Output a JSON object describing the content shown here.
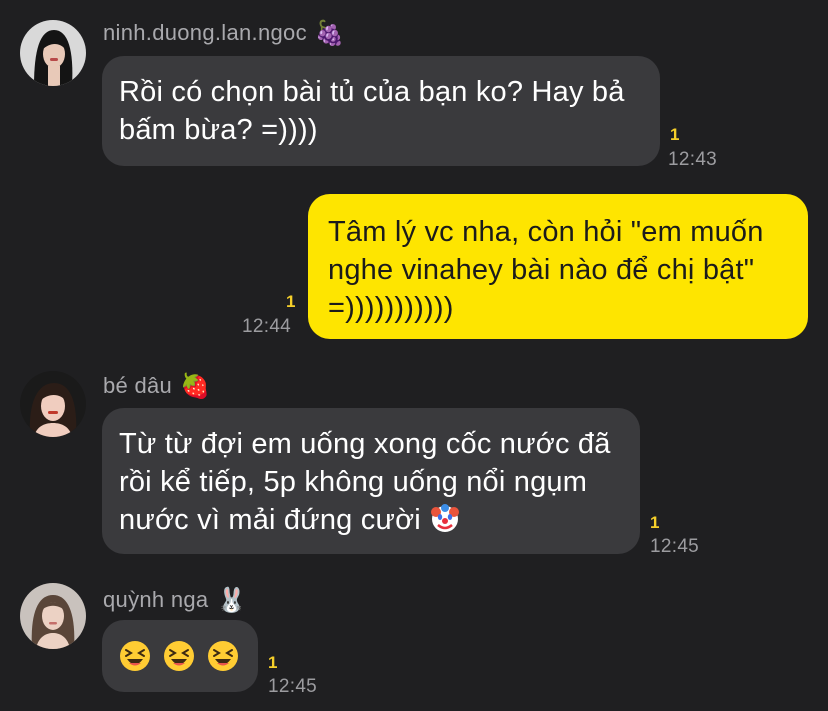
{
  "messages": [
    {
      "sender": "ninh.duong.lan.ngoc",
      "sender_emoji": "🍇",
      "lines": [
        "Rồi có chọn bài tủ của bạn ko? Hay bả",
        "bấm bừa? =))))"
      ],
      "unread": "1",
      "time": "12:43"
    },
    {
      "sender": "",
      "lines": [
        "Tâm lý vc nha, còn hỏi \"em muốn",
        "nghe vinahey bài nào để chị bật\"",
        "=)))))))))))"
      ],
      "unread": "1",
      "time": "12:44"
    },
    {
      "sender": "bé dâu",
      "sender_emoji": "🍓",
      "lines": [
        "Từ từ đợi em uống xong cốc nước đã",
        "rồi kể tiếp, 5p không uống nổi ngụm",
        "nước vì mải đứng cười"
      ],
      "trailing_icon": "clown-face-icon",
      "unread": "1",
      "time": "12:45"
    },
    {
      "sender": "quỳnh nga",
      "sender_emoji": "🐰",
      "icons": [
        "laughing-face-icon",
        "laughing-face-icon",
        "laughing-face-icon"
      ],
      "unread": "1",
      "time": "12:45"
    }
  ],
  "colors": {
    "background": "#1f1f21",
    "incoming_bubble": "#3a3a3d",
    "outgoing_bubble": "#fee500",
    "unread": "#f5cf2a",
    "meta_text": "#9c9ca0"
  }
}
